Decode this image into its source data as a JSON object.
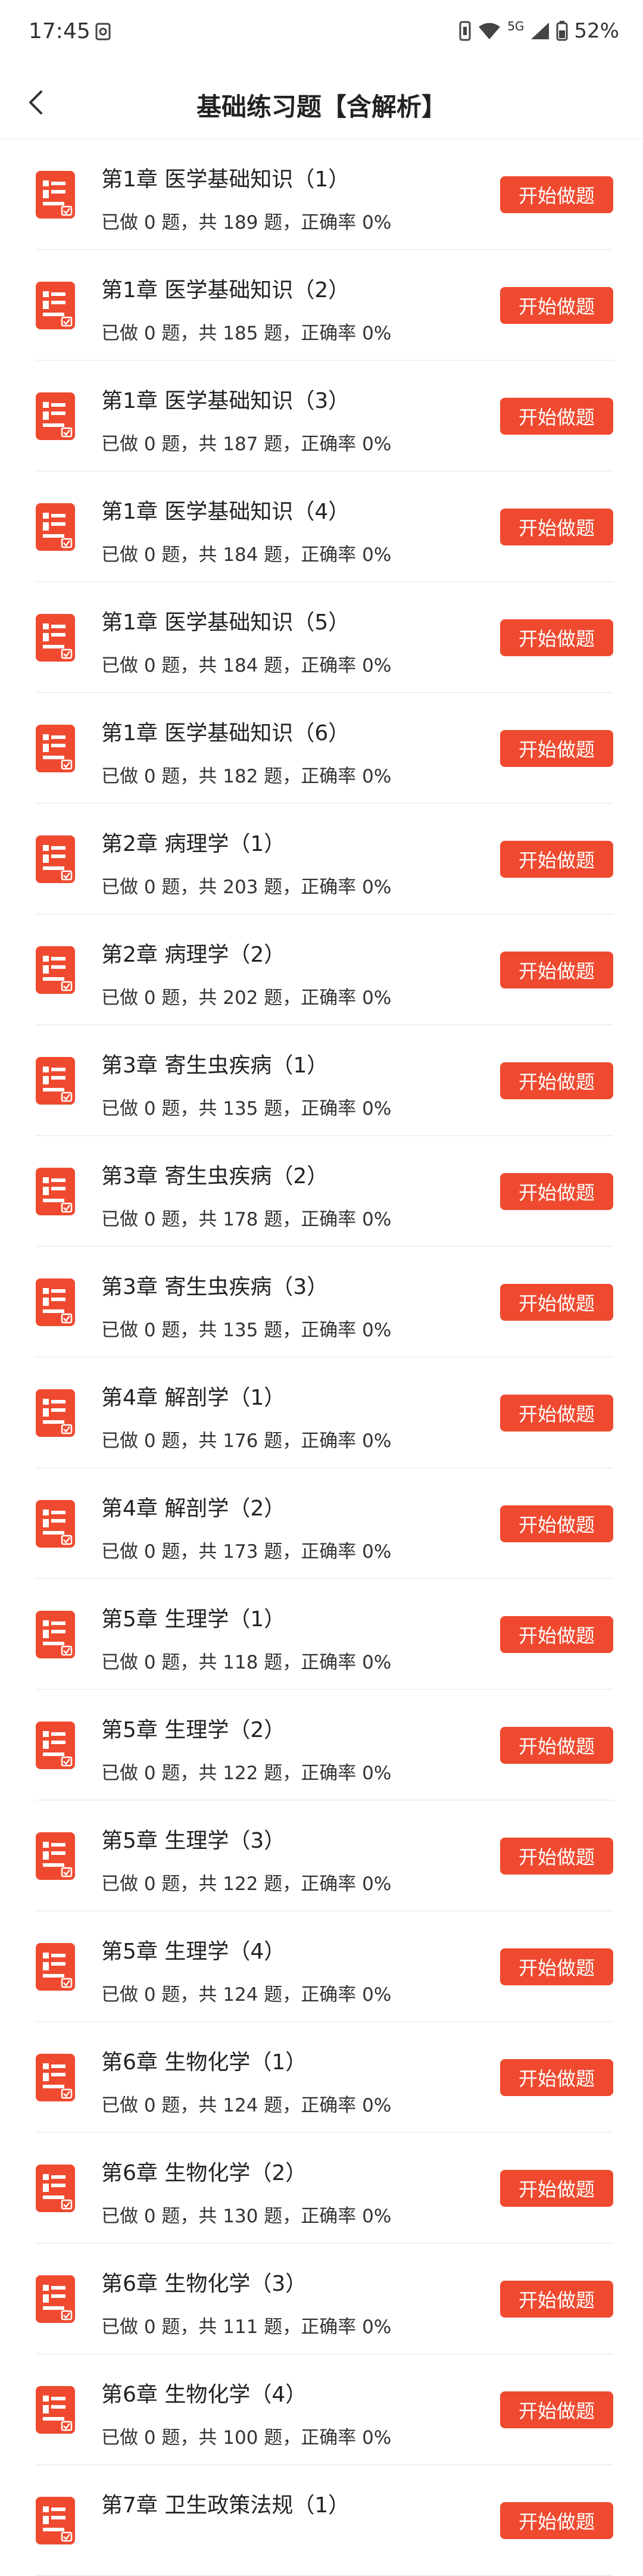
{
  "status_bar": {
    "time": "17:45",
    "network": "5G",
    "battery": "52%",
    "icons": [
      "screencast-icon",
      "vibrate-icon",
      "wifi-icon",
      "signal-icon",
      "battery-icon"
    ]
  },
  "header": {
    "back_icon": "chevron-left-icon",
    "title": "基础练习题【含解析】"
  },
  "colors": {
    "accent": "#ef4a2f",
    "text": "#222222",
    "divider": "#f1f1f1"
  },
  "chapters": [
    {
      "title": "第1章 医学基础知识（1）",
      "stats": "已做 0 题，共 189 题，正确率 0%",
      "button": "开始做题"
    },
    {
      "title": "第1章 医学基础知识（2）",
      "stats": "已做 0 题，共 185 题，正确率 0%",
      "button": "开始做题"
    },
    {
      "title": "第1章 医学基础知识（3）",
      "stats": "已做 0 题，共 187 题，正确率 0%",
      "button": "开始做题"
    },
    {
      "title": "第1章 医学基础知识（4）",
      "stats": "已做 0 题，共 184 题，正确率 0%",
      "button": "开始做题"
    },
    {
      "title": "第1章 医学基础知识（5）",
      "stats": "已做 0 题，共 184 题，正确率 0%",
      "button": "开始做题"
    },
    {
      "title": "第1章 医学基础知识（6）",
      "stats": "已做 0 题，共 182 题，正确率 0%",
      "button": "开始做题"
    },
    {
      "title": "第2章 病理学（1）",
      "stats": "已做 0 题，共 203 题，正确率 0%",
      "button": "开始做题"
    },
    {
      "title": "第2章 病理学（2）",
      "stats": "已做 0 题，共 202 题，正确率 0%",
      "button": "开始做题"
    },
    {
      "title": "第3章 寄生虫疾病（1）",
      "stats": "已做 0 题，共 135 题，正确率 0%",
      "button": "开始做题"
    },
    {
      "title": "第3章 寄生虫疾病（2）",
      "stats": "已做 0 题，共 178 题，正确率 0%",
      "button": "开始做题"
    },
    {
      "title": "第3章 寄生虫疾病（3）",
      "stats": "已做 0 题，共 135 题，正确率 0%",
      "button": "开始做题"
    },
    {
      "title": "第4章 解剖学（1）",
      "stats": "已做 0 题，共 176 题，正确率 0%",
      "button": "开始做题"
    },
    {
      "title": "第4章 解剖学（2）",
      "stats": "已做 0 题，共 173 题，正确率 0%",
      "button": "开始做题"
    },
    {
      "title": "第5章 生理学（1）",
      "stats": "已做 0 题，共 118 题，正确率 0%",
      "button": "开始做题"
    },
    {
      "title": "第5章 生理学（2）",
      "stats": "已做 0 题，共 122 题，正确率 0%",
      "button": "开始做题"
    },
    {
      "title": "第5章 生理学（3）",
      "stats": "已做 0 题，共 122 题，正确率 0%",
      "button": "开始做题"
    },
    {
      "title": "第5章 生理学（4）",
      "stats": "已做 0 题，共 124 题，正确率 0%",
      "button": "开始做题"
    },
    {
      "title": "第6章 生物化学（1）",
      "stats": "已做 0 题，共 124 题，正确率 0%",
      "button": "开始做题"
    },
    {
      "title": "第6章 生物化学（2）",
      "stats": "已做 0 题，共 130 题，正确率 0%",
      "button": "开始做题"
    },
    {
      "title": "第6章 生物化学（3）",
      "stats": "已做 0 题，共 111 题，正确率 0%",
      "button": "开始做题"
    },
    {
      "title": "第6章 生物化学（4）",
      "stats": "已做 0 题，共 100 题，正确率 0%",
      "button": "开始做题"
    },
    {
      "title": "第7章 卫生政策法规（1）",
      "stats": "",
      "button": "开始做题"
    }
  ]
}
